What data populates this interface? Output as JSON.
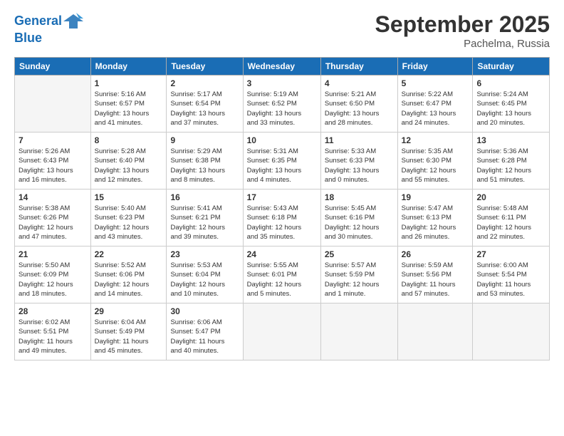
{
  "logo": {
    "line1": "General",
    "line2": "Blue"
  },
  "title": "September 2025",
  "location": "Pachelma, Russia",
  "days_header": [
    "Sunday",
    "Monday",
    "Tuesday",
    "Wednesday",
    "Thursday",
    "Friday",
    "Saturday"
  ],
  "weeks": [
    [
      {
        "num": "",
        "empty": true,
        "info": ""
      },
      {
        "num": "1",
        "info": "Sunrise: 5:16 AM\nSunset: 6:57 PM\nDaylight: 13 hours\nand 41 minutes."
      },
      {
        "num": "2",
        "info": "Sunrise: 5:17 AM\nSunset: 6:54 PM\nDaylight: 13 hours\nand 37 minutes."
      },
      {
        "num": "3",
        "info": "Sunrise: 5:19 AM\nSunset: 6:52 PM\nDaylight: 13 hours\nand 33 minutes."
      },
      {
        "num": "4",
        "info": "Sunrise: 5:21 AM\nSunset: 6:50 PM\nDaylight: 13 hours\nand 28 minutes."
      },
      {
        "num": "5",
        "info": "Sunrise: 5:22 AM\nSunset: 6:47 PM\nDaylight: 13 hours\nand 24 minutes."
      },
      {
        "num": "6",
        "info": "Sunrise: 5:24 AM\nSunset: 6:45 PM\nDaylight: 13 hours\nand 20 minutes."
      }
    ],
    [
      {
        "num": "7",
        "info": "Sunrise: 5:26 AM\nSunset: 6:43 PM\nDaylight: 13 hours\nand 16 minutes."
      },
      {
        "num": "8",
        "info": "Sunrise: 5:28 AM\nSunset: 6:40 PM\nDaylight: 13 hours\nand 12 minutes."
      },
      {
        "num": "9",
        "info": "Sunrise: 5:29 AM\nSunset: 6:38 PM\nDaylight: 13 hours\nand 8 minutes."
      },
      {
        "num": "10",
        "info": "Sunrise: 5:31 AM\nSunset: 6:35 PM\nDaylight: 13 hours\nand 4 minutes."
      },
      {
        "num": "11",
        "info": "Sunrise: 5:33 AM\nSunset: 6:33 PM\nDaylight: 13 hours\nand 0 minutes."
      },
      {
        "num": "12",
        "info": "Sunrise: 5:35 AM\nSunset: 6:30 PM\nDaylight: 12 hours\nand 55 minutes."
      },
      {
        "num": "13",
        "info": "Sunrise: 5:36 AM\nSunset: 6:28 PM\nDaylight: 12 hours\nand 51 minutes."
      }
    ],
    [
      {
        "num": "14",
        "info": "Sunrise: 5:38 AM\nSunset: 6:26 PM\nDaylight: 12 hours\nand 47 minutes."
      },
      {
        "num": "15",
        "info": "Sunrise: 5:40 AM\nSunset: 6:23 PM\nDaylight: 12 hours\nand 43 minutes."
      },
      {
        "num": "16",
        "info": "Sunrise: 5:41 AM\nSunset: 6:21 PM\nDaylight: 12 hours\nand 39 minutes."
      },
      {
        "num": "17",
        "info": "Sunrise: 5:43 AM\nSunset: 6:18 PM\nDaylight: 12 hours\nand 35 minutes."
      },
      {
        "num": "18",
        "info": "Sunrise: 5:45 AM\nSunset: 6:16 PM\nDaylight: 12 hours\nand 30 minutes."
      },
      {
        "num": "19",
        "info": "Sunrise: 5:47 AM\nSunset: 6:13 PM\nDaylight: 12 hours\nand 26 minutes."
      },
      {
        "num": "20",
        "info": "Sunrise: 5:48 AM\nSunset: 6:11 PM\nDaylight: 12 hours\nand 22 minutes."
      }
    ],
    [
      {
        "num": "21",
        "info": "Sunrise: 5:50 AM\nSunset: 6:09 PM\nDaylight: 12 hours\nand 18 minutes."
      },
      {
        "num": "22",
        "info": "Sunrise: 5:52 AM\nSunset: 6:06 PM\nDaylight: 12 hours\nand 14 minutes."
      },
      {
        "num": "23",
        "info": "Sunrise: 5:53 AM\nSunset: 6:04 PM\nDaylight: 12 hours\nand 10 minutes."
      },
      {
        "num": "24",
        "info": "Sunrise: 5:55 AM\nSunset: 6:01 PM\nDaylight: 12 hours\nand 5 minutes."
      },
      {
        "num": "25",
        "info": "Sunrise: 5:57 AM\nSunset: 5:59 PM\nDaylight: 12 hours\nand 1 minute."
      },
      {
        "num": "26",
        "info": "Sunrise: 5:59 AM\nSunset: 5:56 PM\nDaylight: 11 hours\nand 57 minutes."
      },
      {
        "num": "27",
        "info": "Sunrise: 6:00 AM\nSunset: 5:54 PM\nDaylight: 11 hours\nand 53 minutes."
      }
    ],
    [
      {
        "num": "28",
        "info": "Sunrise: 6:02 AM\nSunset: 5:51 PM\nDaylight: 11 hours\nand 49 minutes."
      },
      {
        "num": "29",
        "info": "Sunrise: 6:04 AM\nSunset: 5:49 PM\nDaylight: 11 hours\nand 45 minutes."
      },
      {
        "num": "30",
        "info": "Sunrise: 6:06 AM\nSunset: 5:47 PM\nDaylight: 11 hours\nand 40 minutes."
      },
      {
        "num": "",
        "empty": true,
        "info": ""
      },
      {
        "num": "",
        "empty": true,
        "info": ""
      },
      {
        "num": "",
        "empty": true,
        "info": ""
      },
      {
        "num": "",
        "empty": true,
        "info": ""
      }
    ]
  ]
}
